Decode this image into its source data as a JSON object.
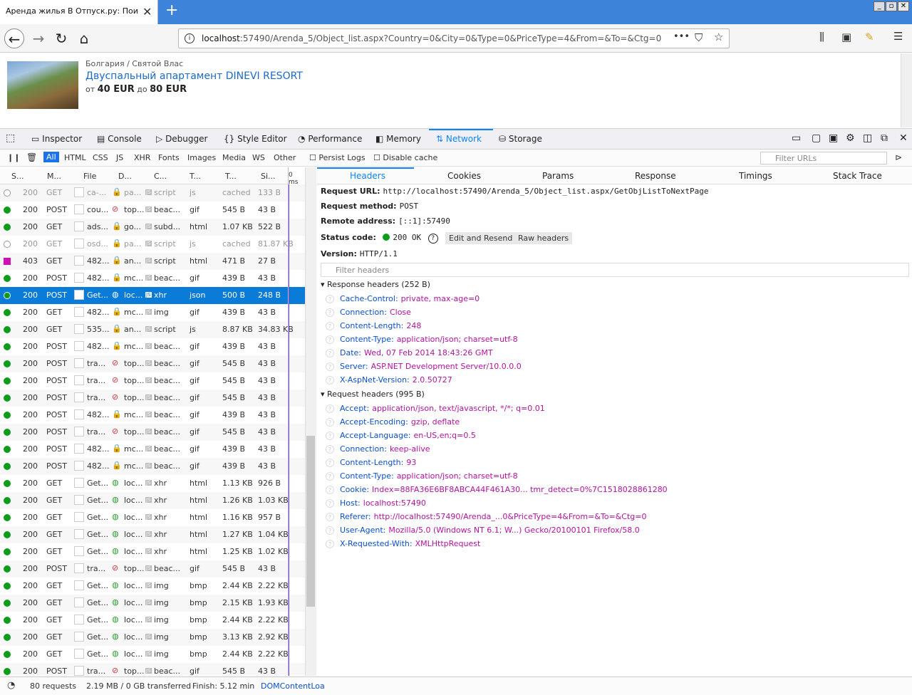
{
  "browser": {
    "tab_title": "Аренда жилья В Отпуск.ру: Поиск о",
    "tab_close": "✕",
    "new_tab": "+",
    "url_host": "localhost",
    "url_rest": ":57490/Arenda_5/Object_list.aspx?Country=0&City=0&Type=0&PriceType=4&From=&To=&Ctg=0",
    "url_more": "•••"
  },
  "page": {
    "breadcrumb": "Болгария  /  Святой Влас",
    "title": "Двуспальный апартамент DINEVI RESORT",
    "price_from_label": "от",
    "price_from": "40 EUR",
    "price_to_label": "до",
    "price_to": "80 EUR"
  },
  "devtools": {
    "tabs": [
      "Inspector",
      "Console",
      "Debugger",
      "Style Editor",
      "Performance",
      "Memory",
      "Network",
      "Storage"
    ],
    "filters": [
      "All",
      "HTML",
      "CSS",
      "JS",
      "XHR",
      "Fonts",
      "Images",
      "Media",
      "WS",
      "Other"
    ],
    "persist_logs": "Persist Logs",
    "disable_cache": "Disable cache",
    "filter_urls_placeholder": "Filter URLs",
    "list_headers": [
      "S...",
      "M...",
      "File",
      "D...",
      "C...",
      "T...",
      "T...",
      "Si...",
      "0 ms"
    ],
    "detail_tabs": [
      "Headers",
      "Cookies",
      "Params",
      "Response",
      "Timings",
      "Stack Trace"
    ]
  },
  "requests": [
    {
      "status": "200",
      "method": "GET",
      "file": "ca-...",
      "domain": "pa...",
      "cause": "script",
      "type": "js",
      "transferred": "cached",
      "size": "133 B",
      "dot": "empty"
    },
    {
      "status": "200",
      "method": "POST",
      "file": "cou...",
      "domain": "top...",
      "cause": "beac...",
      "type": "gif",
      "transferred": "545 B",
      "size": "43 B",
      "dot": "green"
    },
    {
      "status": "200",
      "method": "GET",
      "file": "ads...",
      "domain": "go...",
      "cause": "subd...",
      "type": "html",
      "transferred": "1.07 KB",
      "size": "522 B",
      "dot": "green"
    },
    {
      "status": "200",
      "method": "GET",
      "file": "osd...",
      "domain": "pa...",
      "cause": "script",
      "type": "js",
      "transferred": "cached",
      "size": "81.87 KB",
      "dot": "empty"
    },
    {
      "status": "403",
      "method": "GET",
      "file": "482...",
      "domain": "an...",
      "cause": "script",
      "type": "html",
      "transferred": "471 B",
      "size": "27 B",
      "dot": "magenta"
    },
    {
      "status": "200",
      "method": "POST",
      "file": "482...",
      "domain": "mc...",
      "cause": "beac...",
      "type": "gif",
      "transferred": "439 B",
      "size": "43 B",
      "dot": "green"
    },
    {
      "status": "200",
      "method": "POST",
      "file": "Get...",
      "domain": "loc...",
      "cause": "xhr",
      "type": "json",
      "transferred": "500 B",
      "size": "248 B",
      "dot": "green",
      "selected": true
    },
    {
      "status": "200",
      "method": "GET",
      "file": "482...",
      "domain": "mc...",
      "cause": "img",
      "type": "gif",
      "transferred": "439 B",
      "size": "43 B",
      "dot": "green"
    },
    {
      "status": "200",
      "method": "GET",
      "file": "535...",
      "domain": "an...",
      "cause": "script",
      "type": "js",
      "transferred": "8.87 KB",
      "size": "34.83 KB",
      "dot": "green"
    },
    {
      "status": "200",
      "method": "POST",
      "file": "482...",
      "domain": "mc...",
      "cause": "beac...",
      "type": "gif",
      "transferred": "439 B",
      "size": "43 B",
      "dot": "green"
    },
    {
      "status": "200",
      "method": "POST",
      "file": "tra...",
      "domain": "top...",
      "cause": "beac...",
      "type": "gif",
      "transferred": "545 B",
      "size": "43 B",
      "dot": "green"
    },
    {
      "status": "200",
      "method": "POST",
      "file": "tra...",
      "domain": "top...",
      "cause": "beac...",
      "type": "gif",
      "transferred": "545 B",
      "size": "43 B",
      "dot": "green"
    },
    {
      "status": "200",
      "method": "POST",
      "file": "tra...",
      "domain": "top...",
      "cause": "beac...",
      "type": "gif",
      "transferred": "545 B",
      "size": "43 B",
      "dot": "green"
    },
    {
      "status": "200",
      "method": "POST",
      "file": "482...",
      "domain": "mc...",
      "cause": "beac...",
      "type": "gif",
      "transferred": "439 B",
      "size": "43 B",
      "dot": "green"
    },
    {
      "status": "200",
      "method": "POST",
      "file": "tra...",
      "domain": "top...",
      "cause": "beac...",
      "type": "gif",
      "transferred": "545 B",
      "size": "43 B",
      "dot": "green"
    },
    {
      "status": "200",
      "method": "POST",
      "file": "482...",
      "domain": "mc...",
      "cause": "beac...",
      "type": "gif",
      "transferred": "439 B",
      "size": "43 B",
      "dot": "green"
    },
    {
      "status": "200",
      "method": "POST",
      "file": "482...",
      "domain": "mc...",
      "cause": "beac...",
      "type": "gif",
      "transferred": "439 B",
      "size": "43 B",
      "dot": "green"
    },
    {
      "status": "200",
      "method": "GET",
      "file": "Get...",
      "domain": "loc...",
      "cause": "xhr",
      "type": "html",
      "transferred": "1.13 KB",
      "size": "926 B",
      "dot": "green"
    },
    {
      "status": "200",
      "method": "GET",
      "file": "Get...",
      "domain": "loc...",
      "cause": "xhr",
      "type": "html",
      "transferred": "1.26 KB",
      "size": "1.03 KB",
      "dot": "green"
    },
    {
      "status": "200",
      "method": "GET",
      "file": "Get...",
      "domain": "loc...",
      "cause": "xhr",
      "type": "html",
      "transferred": "1.16 KB",
      "size": "957 B",
      "dot": "green"
    },
    {
      "status": "200",
      "method": "GET",
      "file": "Get...",
      "domain": "loc...",
      "cause": "xhr",
      "type": "html",
      "transferred": "1.27 KB",
      "size": "1.04 KB",
      "dot": "green"
    },
    {
      "status": "200",
      "method": "GET",
      "file": "Get...",
      "domain": "loc...",
      "cause": "xhr",
      "type": "html",
      "transferred": "1.25 KB",
      "size": "1.02 KB",
      "dot": "green"
    },
    {
      "status": "200",
      "method": "POST",
      "file": "tra...",
      "domain": "top...",
      "cause": "beac...",
      "type": "gif",
      "transferred": "545 B",
      "size": "43 B",
      "dot": "green"
    },
    {
      "status": "200",
      "method": "GET",
      "file": "Get...",
      "domain": "loc...",
      "cause": "img",
      "type": "bmp",
      "transferred": "2.44 KB",
      "size": "2.22 KB",
      "dot": "green"
    },
    {
      "status": "200",
      "method": "GET",
      "file": "Get...",
      "domain": "loc...",
      "cause": "img",
      "type": "bmp",
      "transferred": "2.15 KB",
      "size": "1.93 KB",
      "dot": "green"
    },
    {
      "status": "200",
      "method": "GET",
      "file": "Get...",
      "domain": "loc...",
      "cause": "img",
      "type": "bmp",
      "transferred": "2.44 KB",
      "size": "2.22 KB",
      "dot": "green"
    },
    {
      "status": "200",
      "method": "GET",
      "file": "Get...",
      "domain": "loc...",
      "cause": "img",
      "type": "bmp",
      "transferred": "3.13 KB",
      "size": "2.92 KB",
      "dot": "green"
    },
    {
      "status": "200",
      "method": "GET",
      "file": "Get...",
      "domain": "loc...",
      "cause": "img",
      "type": "bmp",
      "transferred": "2.44 KB",
      "size": "2.22 KB",
      "dot": "green"
    },
    {
      "status": "200",
      "method": "POST",
      "file": "tra...",
      "domain": "top...",
      "cause": "beac...",
      "type": "gif",
      "transferred": "545 B",
      "size": "43 B",
      "dot": "green"
    }
  ],
  "details": {
    "request_url_label": "Request URL:",
    "request_url": "http://localhost:57490/Arenda_5/Object_list.aspx/GetObjListToNextPage",
    "request_method_label": "Request method:",
    "request_method": "POST",
    "remote_address_label": "Remote address:",
    "remote_address": "[::1]:57490",
    "status_code_label": "Status code:",
    "status_code": "200 OK",
    "edit_resend": "Edit and Resend",
    "raw_headers": "Raw headers",
    "version_label": "Version:",
    "version": "HTTP/1.1",
    "filter_headers_placeholder": "Filter headers",
    "response_headers_title": "Response headers (252 B)",
    "response_headers": [
      {
        "name": "Cache-Control:",
        "value": "private, max-age=0"
      },
      {
        "name": "Connection:",
        "value": "Close"
      },
      {
        "name": "Content-Length:",
        "value": "248"
      },
      {
        "name": "Content-Type:",
        "value": "application/json; charset=utf-8"
      },
      {
        "name": "Date:",
        "value": "Wed, 07 Feb 2014 18:43:26 GMT"
      },
      {
        "name": "Server:",
        "value": "ASP.NET Development Server/10.0.0.0"
      },
      {
        "name": "X-AspNet-Version:",
        "value": "2.0.50727"
      }
    ],
    "request_headers_title": "Request headers (995 B)",
    "request_headers": [
      {
        "name": "Accept:",
        "value": "application/json, text/javascript, */*; q=0.01"
      },
      {
        "name": "Accept-Encoding:",
        "value": "gzip, deflate"
      },
      {
        "name": "Accept-Language:",
        "value": "en-US,en;q=0.5"
      },
      {
        "name": "Connection:",
        "value": "keep-alive"
      },
      {
        "name": "Content-Length:",
        "value": "93"
      },
      {
        "name": "Content-Type:",
        "value": "application/json; charset=utf-8"
      },
      {
        "name": "Cookie:",
        "value": "Index=88FA36E6BF8ABCA44F461A30... tmr_detect=0%7C1518028861280"
      },
      {
        "name": "Host:",
        "value": "localhost:57490"
      },
      {
        "name": "Referer:",
        "value": "http://localhost:57490/Arenda_...0&PriceType=4&From=&To=&Ctg=0"
      },
      {
        "name": "User-Agent:",
        "value": "Mozilla/5.0 (Windows NT 6.1; W...) Gecko/20100101 Firefox/58.0"
      },
      {
        "name": "X-Requested-With:",
        "value": "XMLHttpRequest"
      }
    ]
  },
  "statusbar": {
    "requests": "80 requests",
    "transferred": "2.19 MB / 0 GB transferred",
    "finish": "Finish: 5.12 min",
    "dom": "DOMContentLoa"
  },
  "colors": {
    "accent": "#0a84ff",
    "selected_row": "#0a7cd7",
    "green": "#0a9d1a",
    "magenta": "#d20fb5",
    "header_name": "#0a4fd0",
    "header_value": "#b5129f"
  }
}
